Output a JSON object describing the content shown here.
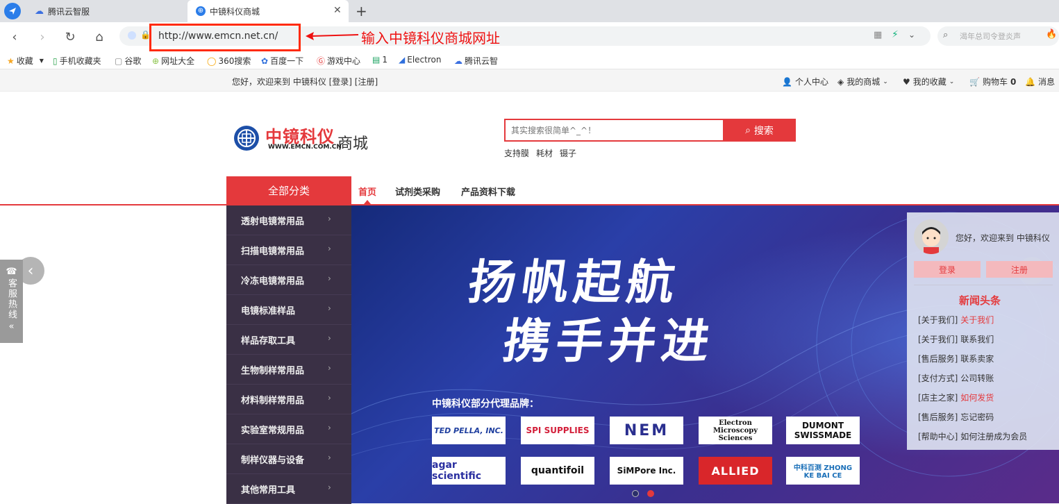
{
  "browser": {
    "tabs": [
      {
        "title": "腾讯云智服"
      },
      {
        "title": "中镜科仪商城"
      }
    ],
    "address": "http://www.emcn.net.cn/",
    "annotation": "输入中镜科仪商城网址",
    "right_search_placeholder": "渴年总司令登炎声"
  },
  "bookmarks": [
    {
      "label": "收藏",
      "icon": "star-icon"
    },
    {
      "label": "手机收藏夹",
      "icon": "phone-icon"
    },
    {
      "label": "谷歌",
      "icon": "page-icon"
    },
    {
      "label": "网址大全",
      "icon": "plus-circle-icon"
    },
    {
      "label": "360搜索",
      "icon": "search-icon"
    },
    {
      "label": "百度一下",
      "icon": "paw-icon"
    },
    {
      "label": "游戏中心",
      "icon": "game-icon"
    },
    {
      "label": "1",
      "icon": "sheet-icon"
    },
    {
      "label": "Electron",
      "icon": "electron-icon"
    },
    {
      "label": "腾讯云智",
      "icon": "cloud-icon"
    }
  ],
  "topbar": {
    "welcome": "您好，欢迎来到 中镜科仪 [登录] [注册]",
    "links": [
      {
        "label": "个人中心"
      },
      {
        "label": "我的商城"
      },
      {
        "label": "我的收藏"
      },
      {
        "label": "购物车"
      },
      {
        "label": "消息"
      }
    ],
    "cart_count": "0"
  },
  "header": {
    "logo_text": "中镜科仪",
    "logo_url": "WWW.EMCN.COM.CN",
    "store_label": "商城",
    "search_placeholder": "其实搜索很简单^_^！",
    "search_button": "搜索",
    "hot_words": [
      "支持膜",
      "耗材",
      "镊子"
    ]
  },
  "nav": {
    "all_categories": "全部分类",
    "items": [
      "首页",
      "试剂类采购",
      "产品资料下载"
    ]
  },
  "categories": [
    "透射电镜常用品",
    "扫描电镜常用品",
    "冷冻电镜常用品",
    "电镜标准样品",
    "样品存取工具",
    "生物制样常用品",
    "材料制样常用品",
    "实验室常规用品",
    "制样仪器与设备",
    "其他常用工具"
  ],
  "banner": {
    "line1": "扬帆起航",
    "line2": "携手并进",
    "brands_title": "中镜科仪部分代理品牌：",
    "brands": [
      "TED PELLA, INC.",
      "SPI SUPPLIES",
      "NEM",
      "Electron Microscopy Sciences",
      "DUMONT SWISSMADE",
      "agar scientific",
      "quantifoil",
      "SiMPore Inc.",
      "ALLIED",
      "中科百测 ZHONG KE BAI CE"
    ],
    "dot_active": 1
  },
  "side_hotline": "客服热线",
  "user_panel": {
    "welcome": "您好，欢迎来到 中镜科仪",
    "login": "登录",
    "register": "注册",
    "news_title": "新闻头条",
    "news": [
      {
        "tag": "[关于我们]",
        "title": "关于我们",
        "highlight": true
      },
      {
        "tag": "[关于我们]",
        "title": "联系我们",
        "highlight": false
      },
      {
        "tag": "[售后服务]",
        "title": "联系卖家",
        "highlight": false
      },
      {
        "tag": "[支付方式]",
        "title": "公司转账",
        "highlight": false
      },
      {
        "tag": "[店主之家]",
        "title": "如何发货",
        "highlight": true
      },
      {
        "tag": "[售后服务]",
        "title": "忘记密码",
        "highlight": false
      },
      {
        "tag": "[帮助中心]",
        "title": "如何注册成为会员",
        "highlight": false
      }
    ]
  },
  "colors": {
    "brand_red": "#e4393c",
    "cat_bg": "#3a3045",
    "banner_blue": "#2a3fa8"
  }
}
